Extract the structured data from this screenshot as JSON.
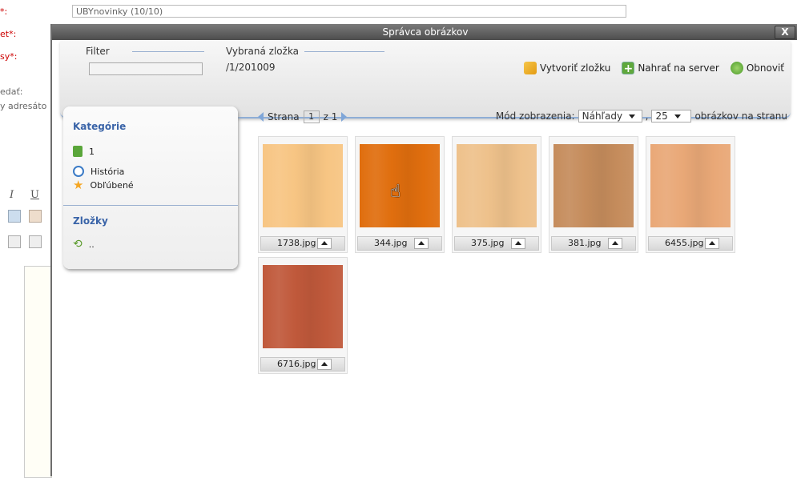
{
  "background_page": {
    "labels": [
      {
        "text": "*:",
        "star": true
      },
      {
        "text": "et*:",
        "star": true
      },
      {
        "text": "sy*:",
        "star": true
      },
      {
        "text": "edať:",
        "star": false
      },
      {
        "text": "y adresáto",
        "star": false
      }
    ],
    "title_input_value": "UBYnovinky (10/10)"
  },
  "modal": {
    "title": "Správca obrázkov",
    "close_label": "X",
    "toolbar": {
      "filter_label": "Filter",
      "filter_value": "",
      "selected_folder_label": "Vybraná zložka",
      "selected_folder_path": "/1/201009",
      "create_folder": "Vytvoriť zložku",
      "upload": "Nahrať na server",
      "refresh": "Obnoviť"
    },
    "sidebar": {
      "categories_title": "Kategórie",
      "categories": [
        {
          "label": "1",
          "icon": "book-icon"
        },
        {
          "label": "História",
          "icon": "clock-icon"
        },
        {
          "label": "Obľúbené",
          "icon": "star-icon"
        }
      ],
      "folders_title": "Zložky",
      "folders": [
        {
          "label": "..",
          "icon": "up-folder-icon"
        }
      ]
    },
    "pager": {
      "prefix": "Strana",
      "page": "1",
      "of": "z 1"
    },
    "view": {
      "mode_label": "Mód zobrazenia:",
      "mode_value": "Náhľady",
      "per_page_value": "25",
      "per_page_suffix": "obrázkov na stranu"
    },
    "images": [
      {
        "name": "1738.jpg",
        "color": "#f7c583"
      },
      {
        "name": "344.jpg",
        "color": "#e06e0e"
      },
      {
        "name": "375.jpg",
        "color": "#eec18b"
      },
      {
        "name": "381.jpg",
        "color": "#c58c5c"
      },
      {
        "name": "6455.jpg",
        "color": "#e9a877"
      },
      {
        "name": "6716.jpg",
        "color": "#c0593b"
      }
    ]
  }
}
